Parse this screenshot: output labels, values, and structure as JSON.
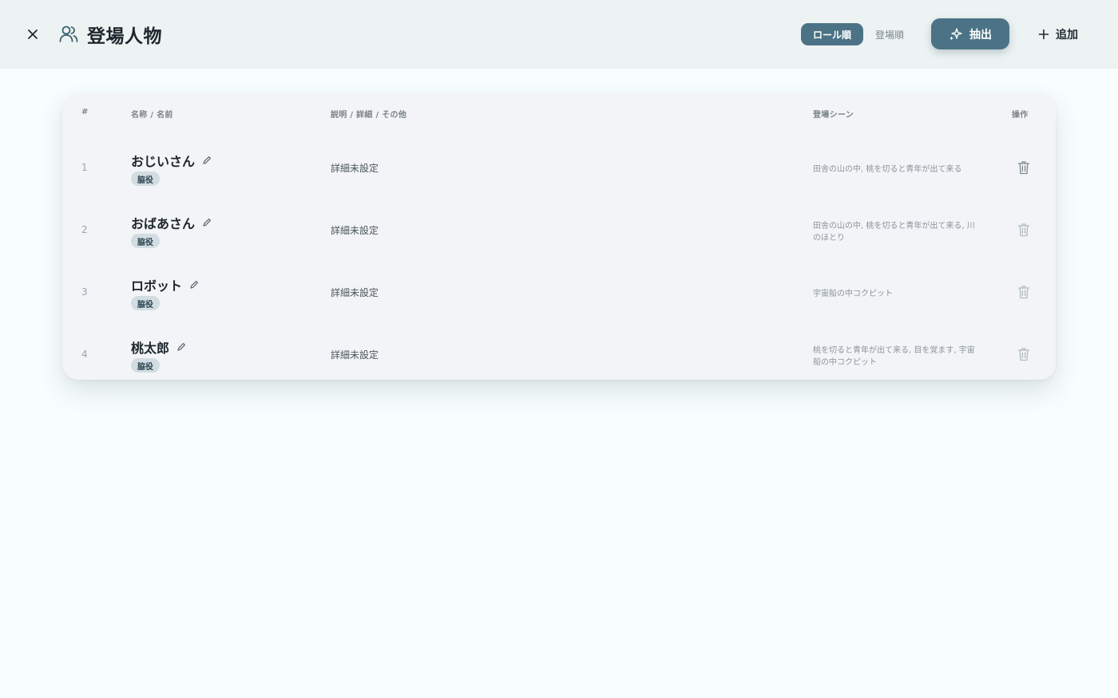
{
  "header": {
    "title": "登場人物",
    "sort_options": [
      "ロール順",
      "登場順"
    ],
    "active_sort": "ロール順",
    "extract_label": "抽出",
    "add_label": "追加"
  },
  "table": {
    "columns": {
      "num": "#",
      "name": "名称 / 名前",
      "desc": "説明 / 詳細 / その他",
      "scene": "登場シーン",
      "action": "操作"
    },
    "rows": [
      {
        "num": "1",
        "name": "おじいさん",
        "role": "脇役",
        "desc": "詳細未設定",
        "scene": "田舎の山の中, 桃を切ると青年が出て来る"
      },
      {
        "num": "2",
        "name": "おばあさん",
        "role": "脇役",
        "desc": "詳細未設定",
        "scene": "田舎の山の中, 桃を切ると青年が出て来る, 川のほとり"
      },
      {
        "num": "3",
        "name": "ロボット",
        "role": "脇役",
        "desc": "詳細未設定",
        "scene": "宇宙船の中コクピット"
      },
      {
        "num": "4",
        "name": "桃太郎",
        "role": "脇役",
        "desc": "詳細未設定",
        "scene": "桃を切ると青年が出て来る, 目を覚ます, 宇宙船の中コクピット"
      }
    ]
  },
  "colors": {
    "accent": "#4b7385",
    "header_bg": "#edf3f3",
    "card_bg": "#f2f4f7",
    "badge_bg": "#d2dde2"
  },
  "icons": {
    "close": "close-icon",
    "title": "users-icon",
    "extract": "sparkle-icon",
    "add": "plus-icon",
    "edit": "pencil-icon",
    "delete": "trash-icon"
  }
}
